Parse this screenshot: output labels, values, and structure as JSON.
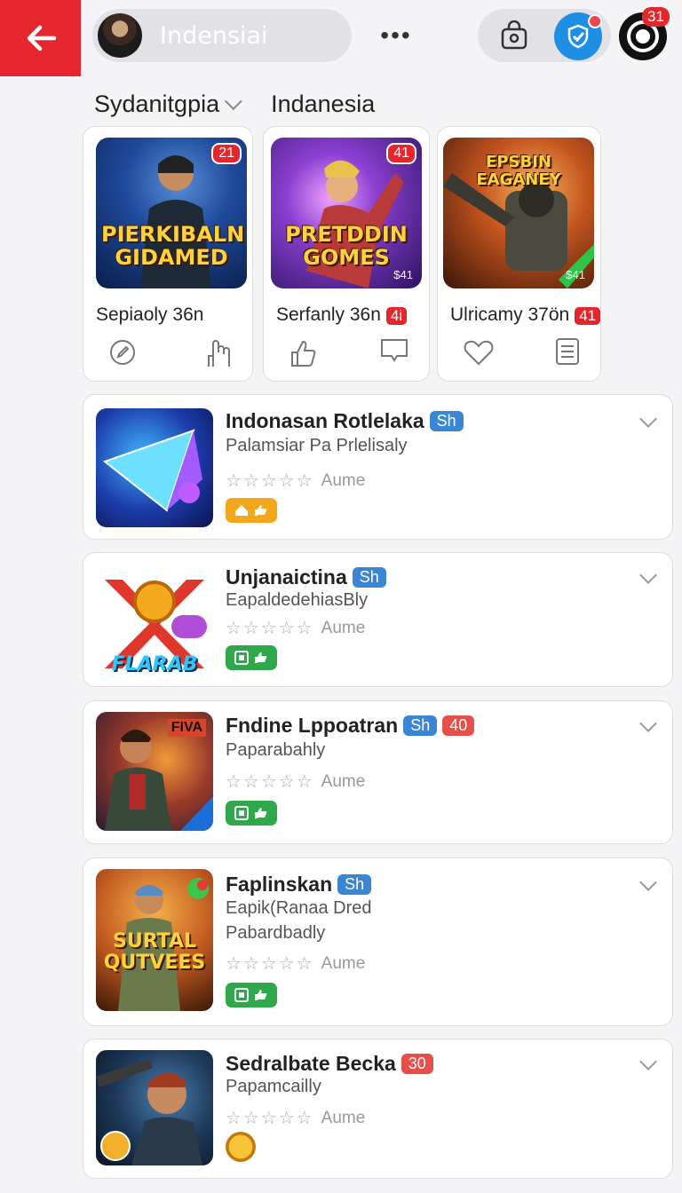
{
  "header": {
    "search_text": "Indensiai",
    "more_label": "•••",
    "notification_count": "31"
  },
  "section": {
    "dropdown_label": "Sydanitgpia",
    "region_label": "Indanesia"
  },
  "featured": [
    {
      "thumb_title": "PIERKIBALN GIDAMED",
      "badge": "21",
      "corner": "",
      "name": "Sepiaoly 36n",
      "rating_badge": "",
      "icons": [
        "edit-circle-icon",
        "hand-icon"
      ]
    },
    {
      "thumb_title": "PRETDDIN GOMES",
      "badge": "41",
      "corner": "$41",
      "name": "Serfanly 36n",
      "rating_badge": "4i",
      "icons": [
        "thumbs-up-icon",
        "bookmark-icon"
      ]
    },
    {
      "thumb_title": "EPSBIN EAGANEY",
      "badge": "",
      "corner": "$41",
      "name": "Ulricamy 37ön",
      "rating_badge": "41",
      "icons": [
        "heart-icon",
        "list-icon"
      ]
    }
  ],
  "apps": [
    {
      "title": "Indonasan Rotlelaka",
      "tags": [
        {
          "text": "Sh",
          "color": "blue"
        }
      ],
      "subs": [
        "Palamsiar Pa Prlelisaly"
      ],
      "rating_text": "Aume",
      "chip": "gold"
    },
    {
      "title": "Unjanaictina",
      "tags": [
        {
          "text": "Sh",
          "color": "blue"
        }
      ],
      "subs": [
        "EapaldedehiasBly"
      ],
      "rating_text": "Aume",
      "chip": "green",
      "thumb_label": "FLARAB"
    },
    {
      "title": "Fndine Lppoatran",
      "tags": [
        {
          "text": "Sh",
          "color": "blue"
        },
        {
          "text": "40",
          "color": "red"
        }
      ],
      "subs": [
        "Paparabahly"
      ],
      "rating_text": "Aume",
      "chip": "green",
      "thumb_label": "FIVA"
    },
    {
      "title": "Faplinskan",
      "tags": [
        {
          "text": "Sh",
          "color": "blue"
        }
      ],
      "subs": [
        "Eapik(Ranaa Dred",
        "Pabardbadly"
      ],
      "rating_text": "Aume",
      "chip": "green",
      "thumb_label": "SURTAL QUTVEES"
    },
    {
      "title": "Sedralbate Becka",
      "tags": [
        {
          "text": "30",
          "color": "red"
        }
      ],
      "subs": [
        "Papamcailly"
      ],
      "rating_text": "Aume",
      "chip": "coin"
    }
  ],
  "stars": "☆☆☆☆☆",
  "colors": {
    "accent": "#e5262d",
    "blue_tag": "#3a86d4",
    "green_chip": "#2ea84a",
    "gold_chip": "#f2a81a"
  }
}
